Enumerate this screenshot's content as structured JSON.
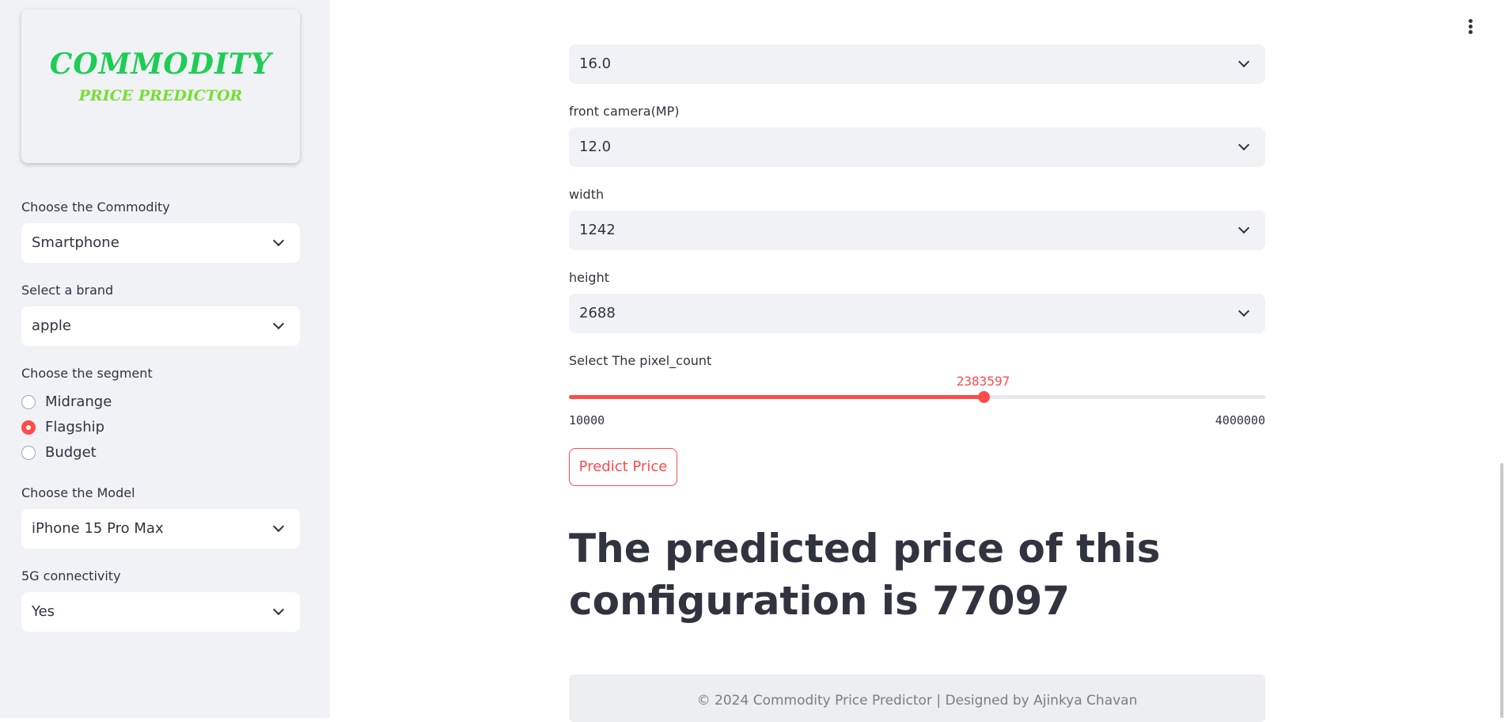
{
  "sidebar": {
    "logo": {
      "line1": "COMMODITY",
      "line2": "PRICE PREDICTOR",
      "colors": {
        "line1": "#1fcc55",
        "line2": "#77dd33"
      }
    },
    "commodity": {
      "label": "Choose the Commodity",
      "value": "Smartphone"
    },
    "brand": {
      "label": "Select a brand",
      "value": "apple"
    },
    "segment": {
      "label": "Choose the segment",
      "options": [
        {
          "label": "Midrange",
          "selected": false
        },
        {
          "label": "Flagship",
          "selected": true
        },
        {
          "label": "Budget",
          "selected": false
        }
      ]
    },
    "model": {
      "label": "Choose the Model",
      "value": "iPhone 15 Pro Max"
    },
    "connectivity": {
      "label": "5G connectivity",
      "value": "Yes"
    }
  },
  "main": {
    "rear_camera": {
      "value": "16.0"
    },
    "front_camera": {
      "label": "front camera(MP)",
      "value": "12.0"
    },
    "width": {
      "label": "width",
      "value": "1242"
    },
    "height": {
      "label": "height",
      "value": "2688"
    },
    "pixel_slider": {
      "label": "Select The pixel_count",
      "value": 2383597,
      "value_text": "2383597",
      "min": 10000,
      "min_text": "10000",
      "max": 4000000,
      "max_text": "4000000"
    },
    "predict_button": "Predict Price",
    "result_text": "The predicted price of this configuration is 77097",
    "footer": "© 2024 Commodity Price Predictor | Designed by Ajinkya Chavan"
  },
  "icons": {
    "dropdown": "chevron-down-icon",
    "menu": "more-vertical-icon"
  },
  "colors": {
    "accent": "#ff4b4b",
    "sidebar_bg": "#f0f2f6",
    "text": "#31333f"
  }
}
